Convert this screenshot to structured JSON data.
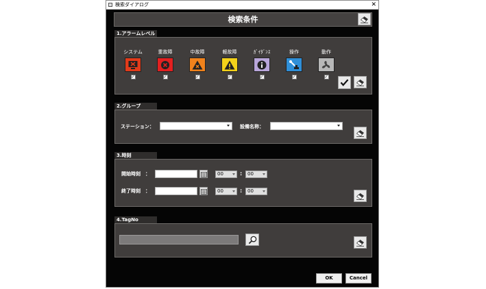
{
  "window": {
    "title": "検索ダイアログ",
    "close": "✕"
  },
  "header": {
    "title": "検索条件"
  },
  "sections": {
    "alarm_level": {
      "label": "1.アラームレベル",
      "items": [
        {
          "label": "システム",
          "color": "#e23b1a",
          "icon": "monitor-x-icon",
          "checked": "✓"
        },
        {
          "label": "重故障",
          "color": "#e32020",
          "icon": "x-circle-icon",
          "checked": "✓"
        },
        {
          "label": "中故障",
          "color": "#f0821c",
          "icon": "warning-x-icon",
          "checked": "✓"
        },
        {
          "label": "軽故障",
          "color": "#f3d11a",
          "icon": "warning-icon",
          "checked": "✓"
        },
        {
          "label": "ｶﾞｲﾀﾞﾝｽ",
          "color": "#b9a6da",
          "icon": "info-icon",
          "checked": "✓"
        },
        {
          "label": "操作",
          "color": "#2f8fd8",
          "icon": "tool-icon",
          "checked": "✓"
        },
        {
          "label": "動作",
          "color": "#b8b8b8",
          "icon": "fan-icon",
          "checked": "✓"
        }
      ]
    },
    "group": {
      "label": "2.グループ",
      "station_label": "ステーション：",
      "equipment_label": "設備名称：",
      "station_value": "",
      "equipment_value": ""
    },
    "time": {
      "label": "3.時刻",
      "start_label": "開始時刻　：",
      "end_label": "終了時刻　：",
      "start": {
        "date": "",
        "hour": "00",
        "minute": "00"
      },
      "end": {
        "date": "",
        "hour": "00",
        "minute": "00"
      },
      "colon": ":"
    },
    "tagno": {
      "label": "4.TagNo",
      "value": ""
    }
  },
  "buttons": {
    "ok": "OK",
    "cancel": "Cancel"
  }
}
